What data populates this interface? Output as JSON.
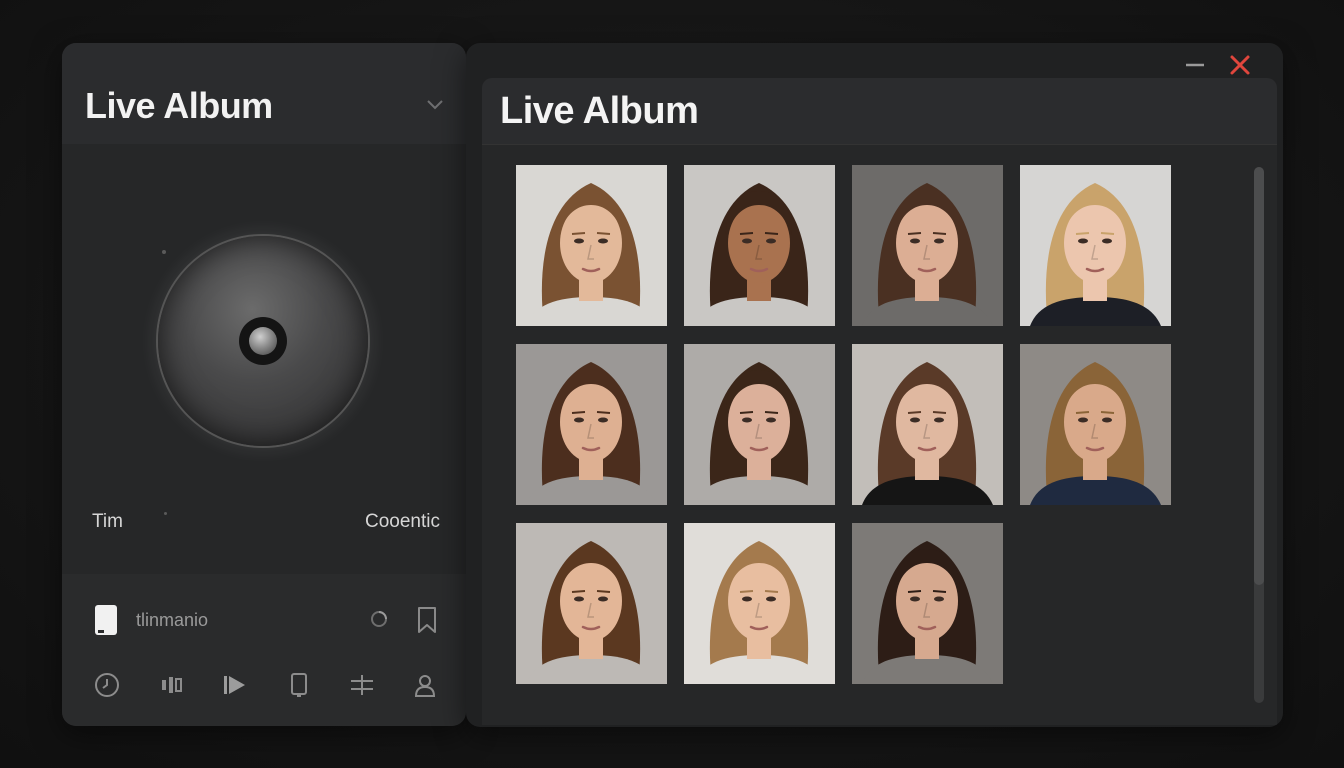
{
  "left_panel": {
    "title": "Live Album",
    "label_left": "Tim",
    "label_right": "Cooentic",
    "track_name": "tlinmanio",
    "nav_icons": [
      "clock-icon",
      "equalizer-icon",
      "play-icon",
      "device-icon",
      "adjust-icon",
      "profile-icon"
    ]
  },
  "window": {
    "title": "Live Album",
    "controls": [
      "minimize-icon",
      "close-icon"
    ]
  },
  "colors": {
    "close": "#e0463d",
    "panel": "#242526",
    "text": "#f2f2f2"
  },
  "photos": [
    {
      "bg": "#d9d7d3",
      "hair": "#7a5232",
      "skin": "#e3b99a",
      "shirt": "#d9d7d3"
    },
    {
      "bg": "#c9c7c4",
      "hair": "#3a2519",
      "skin": "#a9724f",
      "shirt": "#c9c7c4"
    },
    {
      "bg": "#6d6b69",
      "hair": "#4a3022",
      "skin": "#dcae94",
      "shirt": "#6d6b69"
    },
    {
      "bg": "#d6d5d3",
      "hair": "#c9a36b",
      "skin": "#ecc6ae",
      "shirt": "#1d1f26"
    },
    {
      "bg": "#9b9896",
      "hair": "#4c2e1e",
      "skin": "#deb092",
      "shirt": "#9b9896"
    },
    {
      "bg": "#aeaba8",
      "hair": "#3b2619",
      "skin": "#dcb09a",
      "shirt": "#aeaba8"
    },
    {
      "bg": "#c2beb9",
      "hair": "#5a3a28",
      "skin": "#e0b8a0",
      "shirt": "#151515"
    },
    {
      "bg": "#8e8a86",
      "hair": "#8a6438",
      "skin": "#d9a98a",
      "shirt": "#1f2a40"
    },
    {
      "bg": "#bdb9b5",
      "hair": "#5b3820",
      "skin": "#e3b697",
      "shirt": "#bdb9b5"
    },
    {
      "bg": "#e0ddd9",
      "hair": "#a47a4d",
      "skin": "#e8bea0",
      "shirt": "#e0ddd9"
    },
    {
      "bg": "#7d7a77",
      "hair": "#2d1d16",
      "skin": "#d6a98f",
      "shirt": "#7d7a77"
    }
  ]
}
